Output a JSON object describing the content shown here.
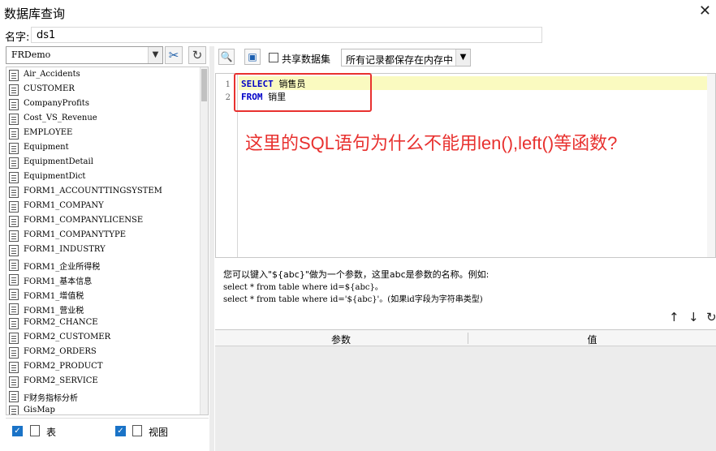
{
  "window": {
    "title": "数据库查询",
    "close_glyph": "✕"
  },
  "name_field": {
    "label": "名字:",
    "value": "ds1"
  },
  "connection": {
    "selected": "FRDemo"
  },
  "tree": {
    "items": [
      "Air_Accidents",
      "CUSTOMER",
      "CompanyProfits",
      "Cost_VS_Revenue",
      "EMPLOYEE",
      "Equipment",
      "EquipmentDetail",
      "EquipmentDict",
      "FORM1_ACCOUNTTINGSYSTEM",
      "FORM1_COMPANY",
      "FORM1_COMPANYLICENSE",
      "FORM1_COMPANYTYPE",
      "FORM1_INDUSTRY",
      "FORM1_企业所得税",
      "FORM1_基本信息",
      "FORM1_增值税",
      "FORM1_营业税",
      "FORM2_CHANCE",
      "FORM2_CUSTOMER",
      "FORM2_ORDERS",
      "FORM2_PRODUCT",
      "FORM2_SERVICE",
      "F财务指标分析",
      "GisMap"
    ]
  },
  "filters": {
    "table_label": "表",
    "view_label": "视图"
  },
  "toolbar": {
    "shared_dataset_label": "共享数据集",
    "storage_mode": "所有记录都保存在内存中"
  },
  "editor": {
    "lines": [
      {
        "no": "1",
        "keyword": "SELECT",
        "rest": " 销售员"
      },
      {
        "no": "2",
        "keyword": "FROM",
        "rest": " 销里"
      }
    ],
    "annotation": "这里的SQL语句为什么不能用len(),left()等函数?"
  },
  "hint": {
    "line1": "您可以键入\"${abc}\"做为一个参数，这里abc是参数的名称。例如:",
    "line2": "select * from table where id=${abc}。",
    "line3": "select * from table where id='${abc}'。(如果id字段为字符串类型)"
  },
  "param_table": {
    "col_param": "参数",
    "col_value": "值"
  },
  "colors": {
    "annotation_red": "#e8312f",
    "keyword_blue": "#0000c8",
    "current_line": "#fafac0",
    "checkbox_blue": "#1a73c7"
  }
}
